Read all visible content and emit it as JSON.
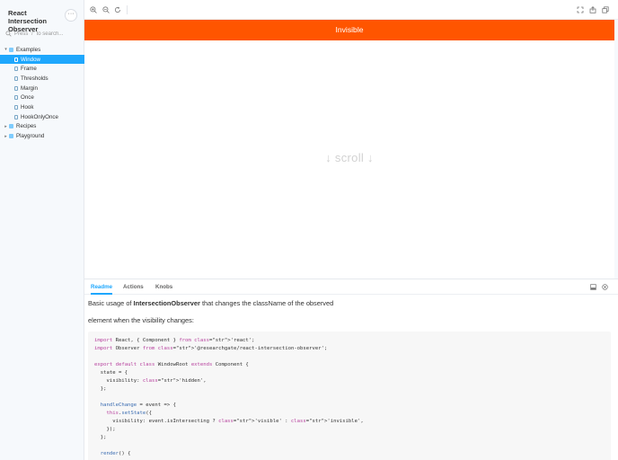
{
  "sidebar": {
    "brand": "React Intersection Observer",
    "menu_label": "···",
    "search_placeholder": "Press \"/\" to search...",
    "tree": [
      {
        "label": "Examples",
        "level": 0,
        "type": "folder",
        "expanded": true
      },
      {
        "label": "Window",
        "level": 1,
        "type": "story",
        "active": true
      },
      {
        "label": "Frame",
        "level": 1,
        "type": "story"
      },
      {
        "label": "Thresholds",
        "level": 1,
        "type": "story"
      },
      {
        "label": "Margin",
        "level": 1,
        "type": "story"
      },
      {
        "label": "Once",
        "level": 1,
        "type": "story"
      },
      {
        "label": "Hook",
        "level": 1,
        "type": "story"
      },
      {
        "label": "HookOnlyOnce",
        "level": 1,
        "type": "story"
      },
      {
        "label": "Recipes",
        "level": 0,
        "type": "folder",
        "expanded": false
      },
      {
        "label": "Playground",
        "level": 0,
        "type": "folder",
        "expanded": false
      }
    ]
  },
  "toolbar": {
    "left_tools": [
      "zoom-in-icon",
      "zoom-out-icon",
      "reset-zoom-icon"
    ],
    "right_tools": [
      "fullscreen-icon",
      "share-icon",
      "copy-icon"
    ]
  },
  "preview": {
    "banner_text": "Invisible",
    "banner_color": "#ff5500",
    "scroll_hint": "↓ scroll ↓"
  },
  "addons": {
    "tabs": [
      "Readme",
      "Actions",
      "Knobs"
    ],
    "active_tab": "Readme",
    "accent": "#1ea7fd",
    "readme": {
      "intro_before": "Basic usage of ",
      "intro_bold": "IntersectionObserver",
      "intro_after": " that changes the className of the observed",
      "intro_line2": "element when the visibility changes:"
    },
    "code_lines": [
      "import React, { Component } from 'react';",
      "import Observer from '@researchgate/react-intersection-observer';",
      "",
      "export default class WindowRoot extends Component {",
      "  state = {",
      "    visibility: 'hidden',",
      "  };",
      "",
      "  handleChange = event => {",
      "    this.setState({",
      "      visibility: event.isIntersecting ? 'visible' : 'invisible',",
      "    });",
      "  };",
      "",
      "  render() {"
    ]
  }
}
